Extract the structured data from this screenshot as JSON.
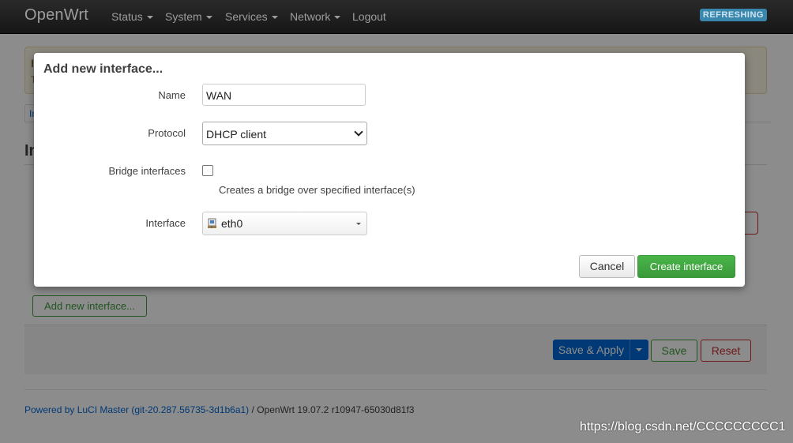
{
  "nav": {
    "brand": "OpenWrt",
    "items": [
      "Status",
      "System",
      "Services",
      "Network",
      "Logout"
    ],
    "badge": "REFRESHING"
  },
  "background": {
    "tab_label": "In",
    "heading": "In",
    "add_button": "Add new interface...",
    "save_apply": "Save & Apply",
    "save": "Save",
    "reset": "Reset",
    "footer_link": "Powered by LuCI Master (git-20.287.56735-3d1b6a1)",
    "footer_text": " / OpenWrt 19.07.2 r10947-65030d81f3"
  },
  "modal": {
    "title": "Add new interface...",
    "name_label": "Name",
    "name_value": "WAN",
    "protocol_label": "Protocol",
    "protocol_value": "DHCP client",
    "bridge_label": "Bridge interfaces",
    "bridge_checked": false,
    "bridge_help": "Creates a bridge over specified interface(s)",
    "interface_label": "Interface",
    "interface_value": "eth0",
    "cancel": "Cancel",
    "create": "Create interface"
  },
  "watermark": "https://blog.csdn.net/CCCCCCCCC1",
  "colors": {
    "primary": "#0069d6",
    "success": "#3a9a3a",
    "danger": "#c62d2d",
    "navbar": "#1b1b1b",
    "badge": "#3a87ad"
  }
}
